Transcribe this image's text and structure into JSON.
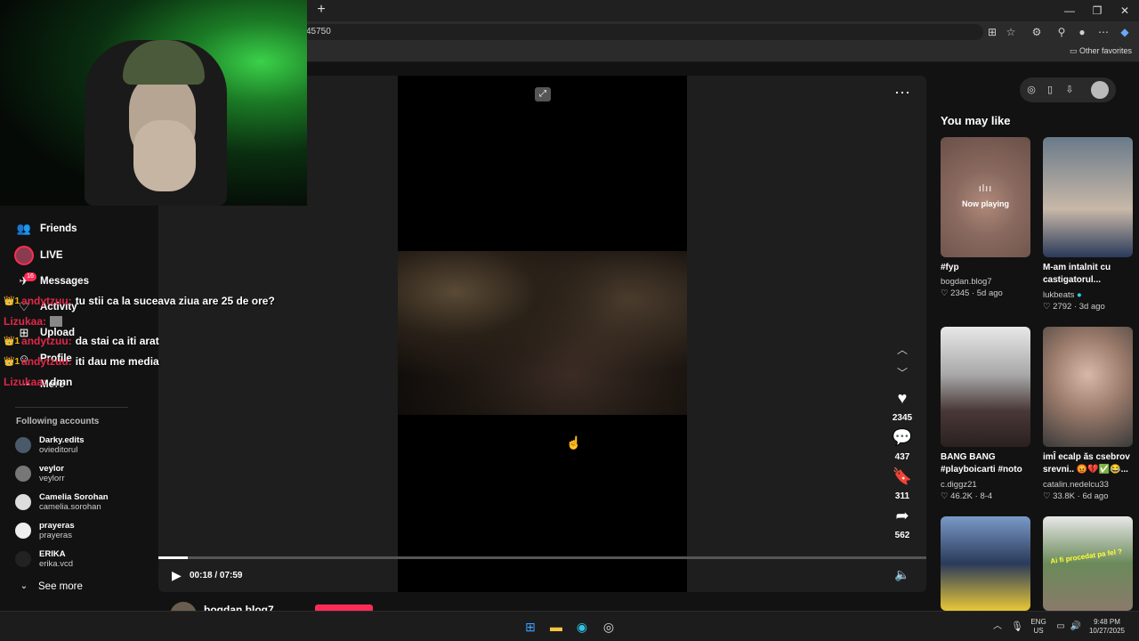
{
  "browser": {
    "new_tab_icon": "+",
    "url_fragment": "45750",
    "window_controls": [
      "—",
      "❐",
      "✕"
    ],
    "other_favorites_label": "Other favorites"
  },
  "sidebar": {
    "items": [
      {
        "label": "Friends",
        "icon": "friends-icon"
      },
      {
        "label": "LIVE",
        "icon": "live-icon"
      },
      {
        "label": "Messages",
        "icon": "messages-icon",
        "badge": "16"
      },
      {
        "label": "Activity",
        "icon": "activity-icon"
      },
      {
        "label": "Upload",
        "icon": "upload-icon"
      },
      {
        "label": "Profile",
        "icon": "profile-icon"
      },
      {
        "label": "More",
        "icon": "more-icon"
      }
    ],
    "following_title": "Following accounts",
    "following": [
      {
        "name": "Darky.edits",
        "handle": "ovieditorul"
      },
      {
        "name": "veylor",
        "handle": "veylorr"
      },
      {
        "name": "Camelia Sorohan",
        "handle": "camelia.sorohan"
      },
      {
        "name": "prayeras",
        "handle": "prayeras"
      },
      {
        "name": "ERIKA",
        "handle": "erika.vcd"
      }
    ],
    "see_more": "See more"
  },
  "chat": [
    {
      "user": "andytzuu:",
      "message": "tu stii ca la suceava ziua are 25 de ore?",
      "badges": "👑1"
    },
    {
      "user": "Lizukaa:",
      "message": "",
      "badges": ""
    },
    {
      "user": "andytzuu:",
      "message": "da stai ca iti arat",
      "badges": "👑1"
    },
    {
      "user": "andytzuu:",
      "message": "iti dau me media",
      "badges": "👑1"
    },
    {
      "user": "Lizukaa:",
      "message": "dmn",
      "badges": ""
    }
  ],
  "player": {
    "time": "00:18 / 07:59",
    "progress_fraction": 0.038,
    "likes": "2345",
    "comments": "437",
    "saves": "311",
    "shares": "562",
    "author": "bogdan.blog7"
  },
  "recommendations": {
    "title": "You may like",
    "now_playing": "Now playing",
    "items": [
      {
        "title": "#fyp",
        "user": "bogdan.blog7",
        "likes": "2345",
        "age": "5d ago"
      },
      {
        "title": "M-am intalnit cu castigatorul...",
        "user": "lukbeats",
        "likes": "2792",
        "age": "3d ago"
      },
      {
        "title": "BANG BANG #playboicarti #noto",
        "user": "c.diggz21",
        "likes": "46.2K",
        "age": "8-4"
      },
      {
        "title": "imÎ ecalp ăs csebrov srevni.. 😡💔✅😂...",
        "user": "catalin.nedelcu33",
        "likes": "33.8K",
        "age": "6d ago"
      },
      {
        "title": "",
        "user": "",
        "likes": "",
        "age": ""
      },
      {
        "title": "Ai fi procedat pa fel ?",
        "user": "",
        "likes": "",
        "age": ""
      }
    ]
  },
  "taskbar": {
    "lang_top": "ENG",
    "lang_bottom": "US",
    "time": "9:48 PM",
    "date": "10/27/2025"
  }
}
